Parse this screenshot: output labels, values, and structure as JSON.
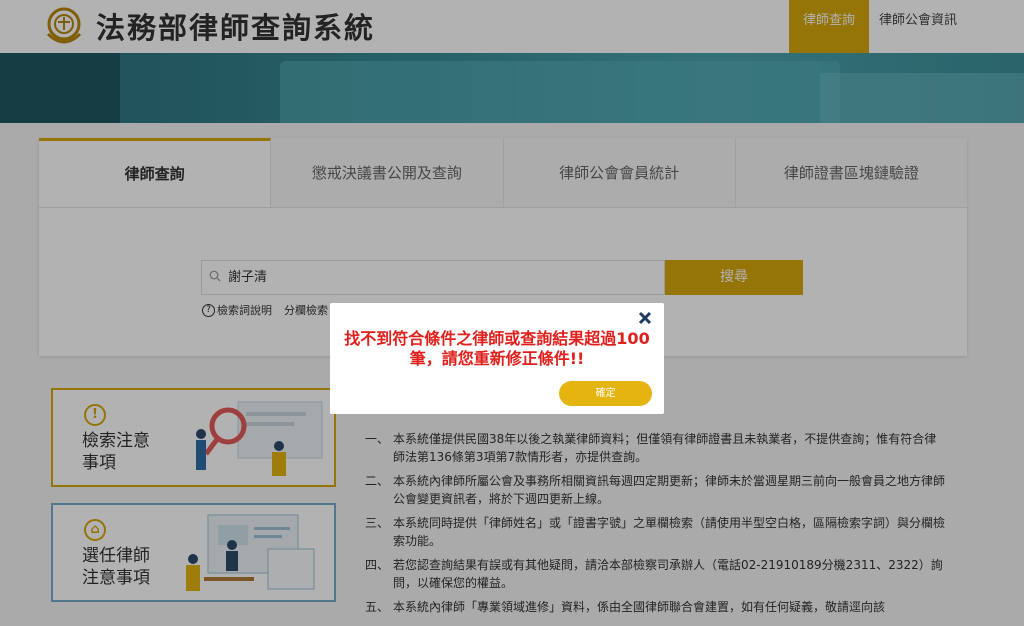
{
  "header": {
    "title": "法務部律師查詢系統",
    "nav": [
      {
        "label": "律師查詢",
        "active": true
      },
      {
        "label": "律師公會資訊",
        "active": false
      }
    ]
  },
  "tabs": [
    {
      "label": "律師查詢",
      "active": true
    },
    {
      "label": "懲戒決議書公開及查詢",
      "active": false
    },
    {
      "label": "律師公會會員統計",
      "active": false
    },
    {
      "label": "律師證書區塊鏈驗證",
      "active": false
    }
  ],
  "search": {
    "value": "謝子清",
    "button_label": "搜尋",
    "help_label": "檢索詞說明",
    "advanced_label": "分欄檢索"
  },
  "info_boxes": [
    {
      "title_line1": "檢索注意",
      "title_line2": "事項",
      "icon": "exclamation-icon"
    },
    {
      "title_line1": "選任律師",
      "title_line2": "注意事項",
      "icon": "building-icon"
    }
  ],
  "notes": [
    {
      "num": "一、",
      "text": "本系統僅提供民國38年以後之執業律師資料；但僅領有律師證書且未執業者，不提供查詢；惟有符合律師法第136條第3項第7款情形者，亦提供查詢。"
    },
    {
      "num": "二、",
      "text": "本系統內律師所屬公會及事務所相關資訊每週四定期更新；律師未於當週星期三前向一般會員之地方律師公會變更資訊者，將於下週四更新上線。"
    },
    {
      "num": "三、",
      "text": "本系統同時提供「律師姓名」或「證書字號」之單欄檢索（請使用半型空白格，區隔檢索字詞）與分欄檢索功能。"
    },
    {
      "num": "四、",
      "text": "若您認查詢結果有誤或有其他疑問，請洽本部檢察司承辦人（電話02-21910189分機2311、2322）詢問，以確保您的權益。"
    },
    {
      "num": "五、",
      "text": "本系統內律師「專業領域進修」資料，係由全國律師聯合會建置，如有任何疑義，敬請逕向該"
    }
  ],
  "modal": {
    "message": "找不到符合條件之律師或查詢結果超過100筆，請您重新修正條件!!",
    "ok_label": "確定"
  },
  "colors": {
    "accent": "#d6a60c",
    "error": "#e0201d",
    "banner": "#3a8e98"
  }
}
